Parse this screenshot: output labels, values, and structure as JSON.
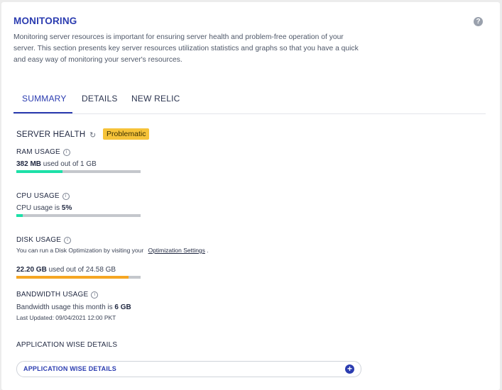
{
  "header": {
    "title": "MONITORING",
    "help_icon": "?",
    "description": "Monitoring server resources is important for ensuring server health and problem-free operation of your server. This section presents key server resources utilization statistics and graphs so that you have a quick and easy way of monitoring your server's resources."
  },
  "tabs": [
    {
      "label": "SUMMARY",
      "active": true
    },
    {
      "label": "DETAILS",
      "active": false
    },
    {
      "label": "NEW RELIC",
      "active": false
    }
  ],
  "server_health": {
    "title": "SERVER HEALTH",
    "refresh_icon": "↻",
    "status": "Problematic",
    "status_color": "#f6c339"
  },
  "ram": {
    "label": "RAM USAGE",
    "info_icon": "i",
    "used": "382 MB",
    "suffix": "used out of 1 GB",
    "fraction": 0.37,
    "color": "#1de0a8"
  },
  "cpu": {
    "label": "CPU USAGE",
    "info_icon": "i",
    "prefix": "CPU usage is",
    "value": "5%",
    "fraction": 0.05,
    "color": "#1de0a8"
  },
  "disk": {
    "label": "DISK USAGE",
    "info_icon": "i",
    "note": "You can run a Disk Optimization by visiting your",
    "link": "Optimization Settings",
    "note_end": ".",
    "used": "22.20 GB",
    "suffix": "used out of 24.58 GB",
    "fraction": 0.9,
    "color": "#f5a623"
  },
  "bandwidth": {
    "label": "BANDWIDTH USAGE",
    "info_icon": "i",
    "prefix": "Bandwidth usage this month is",
    "value": "6 GB",
    "updated": "Last Updated: 09/04/2021 12:00 PKT"
  },
  "application": {
    "title": "APPLICATION WISE DETAILS",
    "button_label": "APPLICATION WISE DETAILS",
    "button_icon": "+"
  }
}
